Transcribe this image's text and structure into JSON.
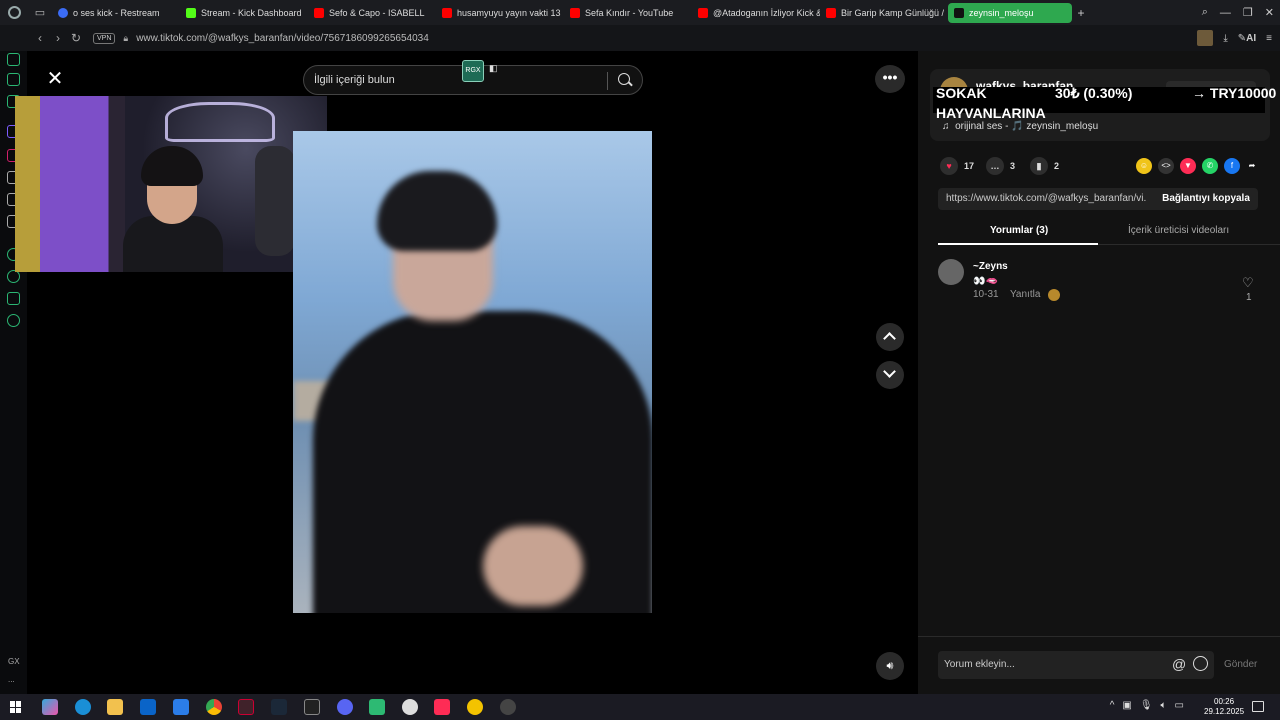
{
  "browser": {
    "tabs": [
      {
        "label": "o ses kick - Restream",
        "icon": "restream-icon",
        "color": "#3b6cf6"
      },
      {
        "label": "Stream - Kick Dashboard",
        "icon": "kick-icon",
        "color": "#53fc18"
      },
      {
        "label": "Sefo & Capo - ISABELL",
        "icon": "youtube-icon",
        "color": "#ff0000"
      },
      {
        "label": "husamyuyu yayın vakti 13",
        "icon": "youtube-icon",
        "color": "#ff0000"
      },
      {
        "label": "Sefa Kındır - YouTube",
        "icon": "youtube-icon",
        "color": "#ff0000"
      },
      {
        "label": "@Atadoganın İzliyor Kick &",
        "icon": "youtube-icon",
        "color": "#ff0000"
      },
      {
        "label": "Bir Garip Kamp Günlüğü /",
        "icon": "youtube-icon",
        "color": "#ff0000"
      },
      {
        "label": "zeynsin_meloşu",
        "icon": "tiktok-icon",
        "color": "#2ea84f",
        "active": true
      }
    ],
    "url": "www.tiktok.com/@wafkys_baranfan/video/7567186099265654034",
    "vpn_label": "VPN",
    "ai_label": "AI"
  },
  "sidebar": {
    "gx_label": "GX",
    "more_label": "..."
  },
  "search": {
    "placeholder": "İlgili içeriği bulun",
    "rgx_label": "RGX"
  },
  "creator": {
    "username": "wafkys_baranfan",
    "music": "orijinal ses - 🎵 zeynsin_meloşu"
  },
  "overlay": {
    "line1_left": "SOKAK",
    "line1_mid": "30₺ (0.30%)",
    "line1_right": "→ TRY10000",
    "line2": "HAYVANLARINA"
  },
  "actions": {
    "likes": "17",
    "comments": "3",
    "saves": "2"
  },
  "link": {
    "url": "https://www.tiktok.com/@wafkys_baranfan/vi...",
    "copy_label": "Bağlantıyı kopyala"
  },
  "tabs": {
    "comments": "Yorumlar (3)",
    "videos": "İçerik üreticisi videoları"
  },
  "comment": {
    "name": "~Zeyns",
    "text": "👀🫦",
    "date": "10-31",
    "reply": "Yanıtla",
    "likes": "1"
  },
  "comment_input": {
    "placeholder": "Yorum ekleyin...",
    "send": "Gönder"
  },
  "taskbar": {
    "time": "00:26",
    "date": "29.12.2025"
  }
}
